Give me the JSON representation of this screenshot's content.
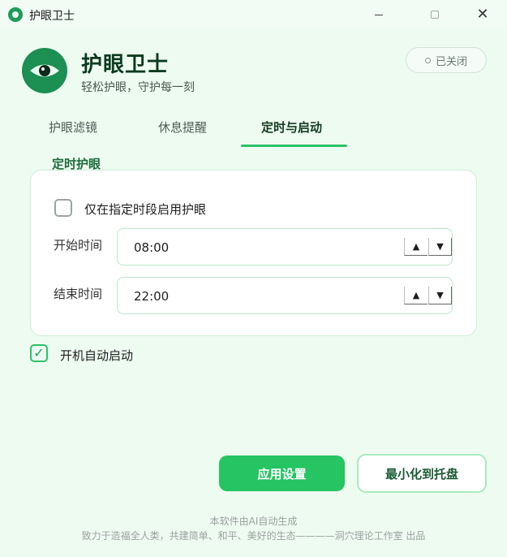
{
  "window": {
    "title": "护眼卫士",
    "close_glyph": "✕"
  },
  "header": {
    "app_name": "护眼卫士",
    "slogan": "轻松护眼，守护每一刻",
    "status": {
      "text": "已关闭",
      "icon": "circle-outline-icon"
    }
  },
  "tabs": [
    {
      "label": "护眼滤镜",
      "active": false
    },
    {
      "label": "休息提醒",
      "active": false
    },
    {
      "label": "定时与启动",
      "active": true
    }
  ],
  "schedule": {
    "section_title": "定时护眼",
    "enable_label": "仅在指定时段启用护眼",
    "enable_checked": false,
    "start_label": "开始时间",
    "start_value": "08:00",
    "end_label": "结束时间",
    "end_value": "22:00",
    "up_glyph": "▲",
    "down_glyph": "▼"
  },
  "autostart": {
    "label": "开机自动启动",
    "checked": true,
    "check_glyph": "✓"
  },
  "buttons": {
    "apply": "应用设置",
    "tray": "最小化到托盘"
  },
  "footer": {
    "line1": "本软件由AI自动生成",
    "line2": "致力于造福全人类，共建简单、和平、美好的生态————洞穴理论工作室 出品"
  },
  "colors": {
    "accent": "#26c463",
    "dark_green": "#1c8f52",
    "background": "#eefbf1"
  }
}
